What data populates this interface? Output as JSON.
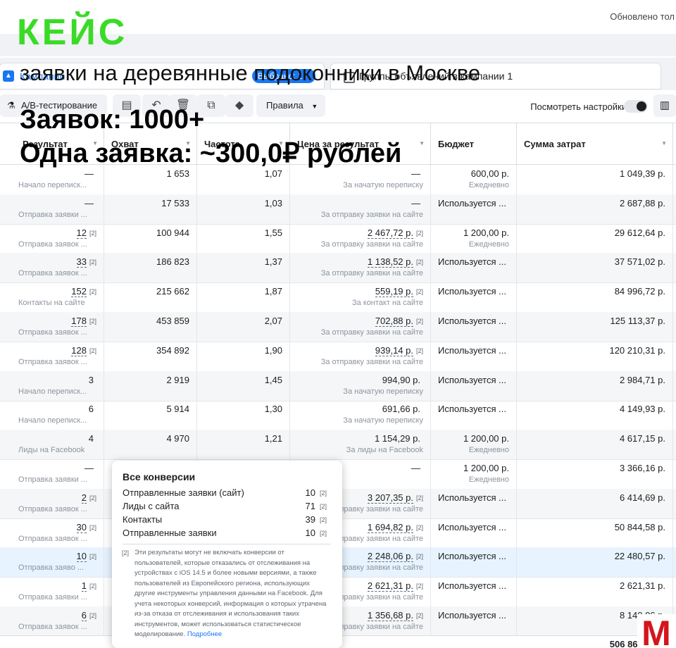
{
  "header": {
    "updated_text": "Обновлено тол"
  },
  "tabs": [
    {
      "label": "Кампании",
      "pill": "Выбрано: 1"
    },
    {
      "label": "Группы объявлений в кампании 1"
    }
  ],
  "toolbar": {
    "ab_test_label": "A/B-тестирование",
    "rules_label": "Правила",
    "settings_label": "Посмотреть настройки",
    "icons": [
      "clipboard-icon",
      "undo-icon",
      "trash-icon",
      "duplicate-icon",
      "tag-icon",
      "columns-icon"
    ]
  },
  "table": {
    "columns": [
      "Результат",
      "Охват",
      "Частота",
      "Цена за результат",
      "Бюджет",
      "Сумма затрат"
    ],
    "rows": [
      {
        "result": "—",
        "result_fn": "",
        "result_sub": "Начало переписк...",
        "reach": "1 653",
        "freq": "1,07",
        "cost": "—",
        "cost_fn": "",
        "cost_sub": "За начатую переписку",
        "budget": "600,00 р.",
        "budget_sub": "Ежедневно",
        "spent": "1 049,39 р."
      },
      {
        "result": "—",
        "result_fn": "",
        "result_sub": "Отправка заявки ...",
        "reach": "17 533",
        "freq": "1,03",
        "cost": "—",
        "cost_fn": "",
        "cost_sub": "За отправку заявки на сайте",
        "budget": "Используется ...",
        "budget_sub": "",
        "spent": "2 687,88 р."
      },
      {
        "result": "12",
        "result_fn": "[2]",
        "result_sub": "Отправка заявок ...",
        "reach": "100 944",
        "freq": "1,55",
        "cost": "2 467,72 р.",
        "cost_fn": "[2]",
        "cost_sub": "За отправку заявки на сайте",
        "budget": "1 200,00 р.",
        "budget_sub": "Ежедневно",
        "spent": "29 612,64 р."
      },
      {
        "result": "33",
        "result_fn": "[2]",
        "result_sub": "Отправка заявок ...",
        "reach": "186 823",
        "freq": "1,37",
        "cost": "1 138,52 р.",
        "cost_fn": "[2]",
        "cost_sub": "За отправку заявки на сайте",
        "budget": "Используется ...",
        "budget_sub": "",
        "spent": "37 571,02 р."
      },
      {
        "result": "152",
        "result_fn": "[2]",
        "result_sub": "Контакты на сайте",
        "reach": "215 662",
        "freq": "1,87",
        "cost": "559,19 р.",
        "cost_fn": "[2]",
        "cost_sub": "За контакт на сайте",
        "budget": "Используется ...",
        "budget_sub": "",
        "spent": "84 996,72 р."
      },
      {
        "result": "178",
        "result_fn": "[2]",
        "result_sub": "Отправка заявок ...",
        "reach": "453 859",
        "freq": "2,07",
        "cost": "702,88 р.",
        "cost_fn": "[2]",
        "cost_sub": "За отправку заявки на сайте",
        "budget": "Используется ...",
        "budget_sub": "",
        "spent": "125 113,37 р."
      },
      {
        "result": "128",
        "result_fn": "[2]",
        "result_sub": "Отправка заявок ...",
        "reach": "354 892",
        "freq": "1,90",
        "cost": "939,14 р.",
        "cost_fn": "[2]",
        "cost_sub": "За отправку заявки на сайте",
        "budget": "Используется ...",
        "budget_sub": "",
        "spent": "120 210,31 р."
      },
      {
        "result": "3",
        "result_fn": "",
        "result_sub": "Начало переписк...",
        "reach": "2 919",
        "freq": "1,45",
        "cost": "994,90 р.",
        "cost_fn": "",
        "cost_sub": "За начатую переписку",
        "budget": "Используется ...",
        "budget_sub": "",
        "spent": "2 984,71 р."
      },
      {
        "result": "6",
        "result_fn": "",
        "result_sub": "Начало переписк...",
        "reach": "5 914",
        "freq": "1,30",
        "cost": "691,66 р.",
        "cost_fn": "",
        "cost_sub": "За начатую переписку",
        "budget": "Используется ...",
        "budget_sub": "",
        "spent": "4 149,93 р."
      },
      {
        "result": "4",
        "result_fn": "",
        "result_sub": "Лиды на Facebook",
        "reach": "4 970",
        "freq": "1,21",
        "cost": "1 154,29 р.",
        "cost_fn": "",
        "cost_sub": "За лиды на Facebook",
        "budget": "1 200,00 р.",
        "budget_sub": "Ежедневно",
        "spent": "4 617,15 р."
      },
      {
        "result": "—",
        "result_fn": "",
        "result_sub": "Отправка заявки ...",
        "reach": "",
        "freq": "",
        "cost": "—",
        "cost_fn": "",
        "cost_sub": "",
        "budget": "1 200,00 р.",
        "budget_sub": "Ежедневно",
        "spent": "3 366,16 р."
      },
      {
        "result": "2",
        "result_fn": "[2]",
        "result_sub": "Отправка заявок ...",
        "reach": "",
        "freq": "",
        "cost": "3 207,35 р.",
        "cost_fn": "[2]",
        "cost_sub": "За отправку заявки на сайте",
        "budget": "Используется ...",
        "budget_sub": "",
        "spent": "6 414,69 р."
      },
      {
        "result": "30",
        "result_fn": "[2]",
        "result_sub": "Отправка заявок ...",
        "reach": "",
        "freq": "",
        "cost": "1 694,82 р.",
        "cost_fn": "[2]",
        "cost_sub": "За отправку заявки на сайте",
        "budget": "Используется ...",
        "budget_sub": "",
        "spent": "50 844,58 р."
      },
      {
        "result": "10",
        "result_fn": "[2]",
        "result_sub": "Отправка заяво ...",
        "reach": "",
        "freq": "",
        "cost": "2 248,06 р.",
        "cost_fn": "[2]",
        "cost_sub": "За отправку заявки на сайте",
        "budget": "Используется ...",
        "budget_sub": "",
        "spent": "22 480,57 р."
      },
      {
        "result": "1",
        "result_fn": "[2]",
        "result_sub": "Отправка заявки ...",
        "reach": "",
        "freq": "",
        "cost": "2 621,31 р.",
        "cost_fn": "[2]",
        "cost_sub": "За отправку заявки на сайте",
        "budget": "Используется ...",
        "budget_sub": "",
        "spent": "2 621,31 р."
      },
      {
        "result": "6",
        "result_fn": "[2]",
        "result_sub": "Отправка заявок ...",
        "reach": "",
        "freq": "",
        "cost": "1 356,68 р.",
        "cost_fn": "[2]",
        "cost_sub": "За отправку заявки на сайте",
        "budget": "Используется ...",
        "budget_sub": "",
        "spent": "8 140,06 р."
      }
    ],
    "total_spent": "506 860,49 р."
  },
  "popover": {
    "title": "Все конверсии",
    "items": [
      {
        "label": "Отправленные заявки (сайт)",
        "value": "10",
        "fn": "[2]"
      },
      {
        "label": "Лиды с сайта",
        "value": "71",
        "fn": "[2]"
      },
      {
        "label": "Контакты",
        "value": "39",
        "fn": "[2]"
      },
      {
        "label": "Отправленные заявки",
        "value": "10",
        "fn": "[2]"
      }
    ],
    "note_mark": "[2]",
    "note": "Эти результаты могут не включать конверсии от пользователей, которые отказались от отслеживания на устройствах с iOS 14.5 и более новыми версиями, а также пользователей из Европейского региона, использующих другие инструменты управления данными на Facebook. Для учета некоторых конверсий, информация о которых утрачена из-за отказа от отслеживания и использования таких инструментов, может использоваться статистическое моделирование.",
    "more_link": "Подробнее"
  },
  "overlay": {
    "case_label": "КЕЙС",
    "subtitle": "заявки на деревянные подоконники в Москве",
    "leads_line": "Заявок: 1000+",
    "price_line": "Одна заявка:  ~300,0₽ рублей"
  },
  "colors": {
    "brand_green": "#3adb26",
    "fb_blue": "#1877f2",
    "logo_red": "#d4151c",
    "selected_row": "#e7f3ff"
  },
  "logo": {
    "letter": "M"
  }
}
